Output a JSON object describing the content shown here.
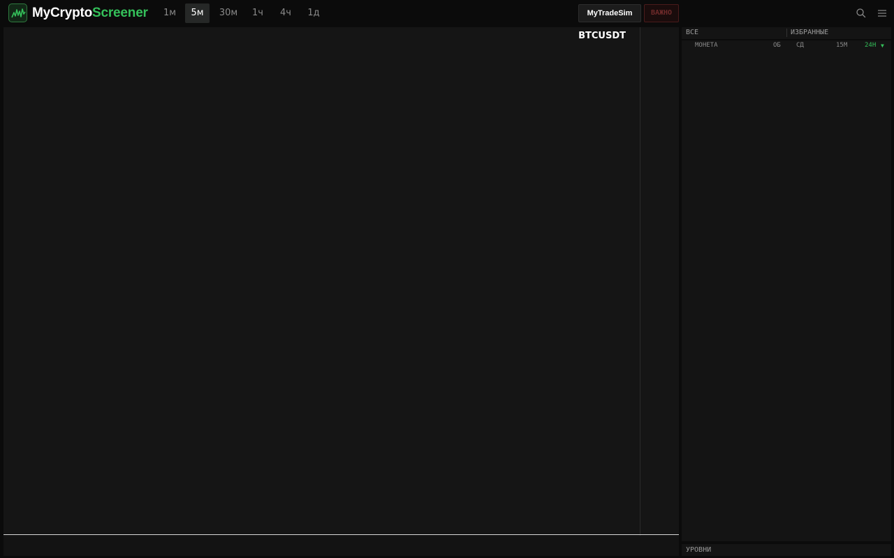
{
  "header": {
    "brand_primary": "MyCrypto",
    "brand_accent": "Screener",
    "timeframes": [
      {
        "label": "1м",
        "active": false
      },
      {
        "label": "5м",
        "active": true
      },
      {
        "label": "30м",
        "active": false
      },
      {
        "label": "1ч",
        "active": false
      },
      {
        "label": "4ч",
        "active": false
      },
      {
        "label": "1д",
        "active": false
      }
    ],
    "sim_button": "MyTradeSim",
    "important_button": "ВАЖНО",
    "icons": [
      "search-icon",
      "hamburger-menu-icon"
    ]
  },
  "chart": {
    "symbol": "BTCUSDT"
  },
  "sidebar": {
    "tabs": [
      "ВСЕ",
      "ИЗБРАННЫЕ"
    ],
    "columns": {
      "coin": "МОНЕТА",
      "volume": "ОБ",
      "trades": "СД",
      "change_15m": "15М",
      "change_24h": "24Н",
      "sort_indicator": "▼"
    },
    "levels_label": "УРОВНИ"
  },
  "colors": {
    "accent_green": "#34c05a",
    "background": "#0b0b0b",
    "panel": "#151515",
    "important_red": "#6e2a2a"
  }
}
